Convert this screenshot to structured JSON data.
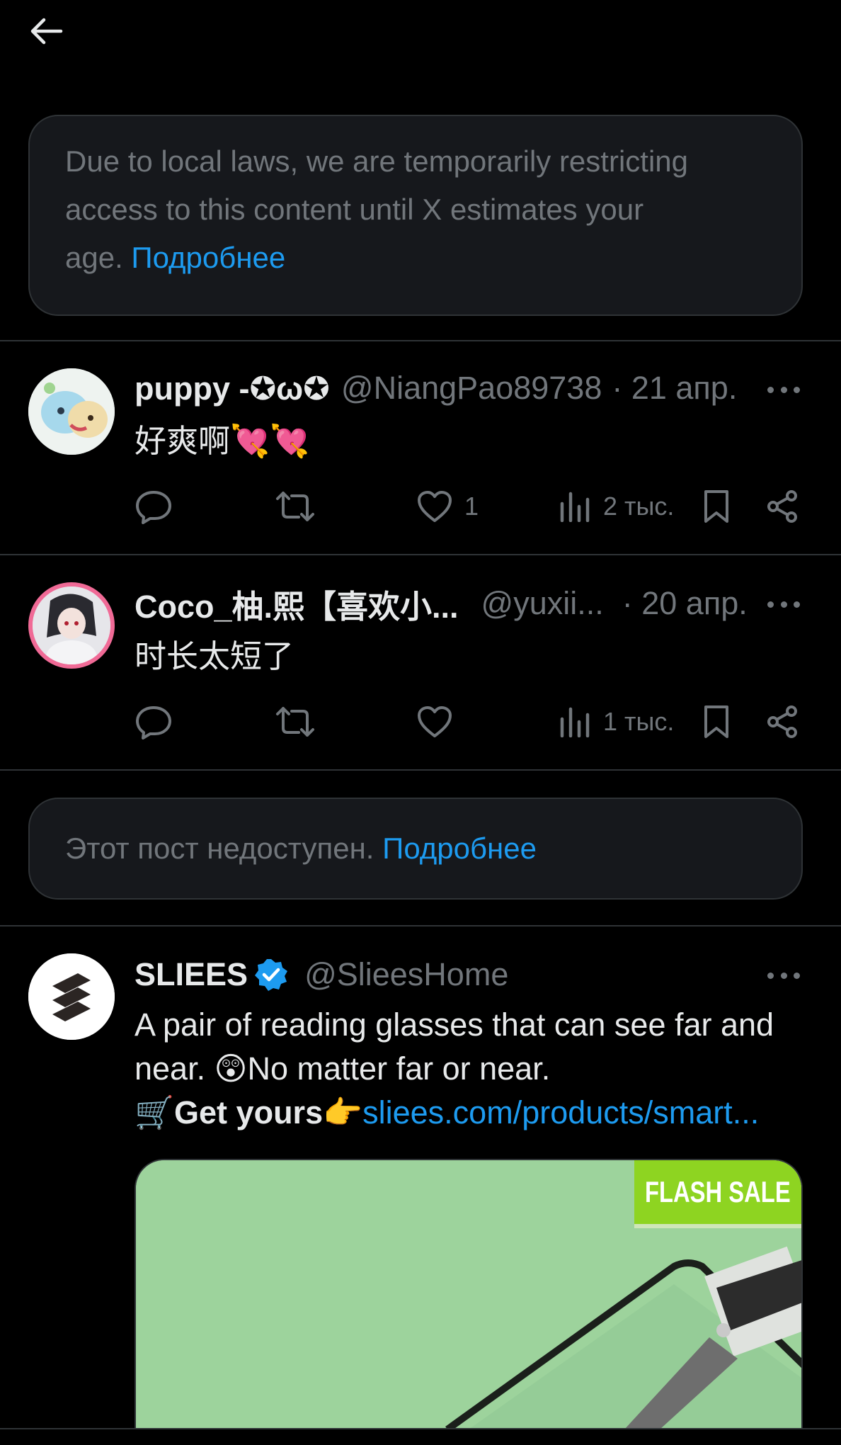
{
  "notice_age": {
    "line1": "Due to local laws, we are temporarily restricting",
    "line2": "access to this content until X estimates your",
    "line3": "age.",
    "link": "Подробнее"
  },
  "posts": [
    {
      "name": "puppy -✪ω✪",
      "handle": "@NiangPao89738",
      "date": "· 21 апр.",
      "text": "好爽啊",
      "emoji": "💘💘",
      "likes": "1",
      "views": "2 тыс."
    },
    {
      "name": "Coco_柚.熙【喜欢小...",
      "handle": "@yuxii...",
      "date": "· 20 апр.",
      "text": "时长太短了",
      "likes": "",
      "views": "1 тыс."
    }
  ],
  "notice_unavailable": {
    "text": "Этот пост недоступен.",
    "link": "Подробнее"
  },
  "ad": {
    "name": "SLIEES",
    "handle": "@SlieesHome",
    "line1": "A pair of reading glasses that can see far and",
    "line2_emoji": "😲",
    "line2": "No matter far or near.",
    "line3_cart": "🛒",
    "line3_bold": "Get yours",
    "line3_point": "👉",
    "line3_link": "sliees.com/products/smart...",
    "media_badge": "FLASH SALE",
    "line2_prefix": "near. "
  },
  "colors": {
    "background": "#000000",
    "card": "#16181c",
    "border": "#2f3336",
    "muted": "#71767b",
    "link": "#1d9bf0",
    "verified": "#1d9bf0"
  },
  "icons": [
    "back-arrow-icon",
    "reply-icon",
    "repost-icon",
    "like-icon",
    "views-icon",
    "bookmark-icon",
    "share-icon",
    "more-icon",
    "verified-badge-icon"
  ]
}
